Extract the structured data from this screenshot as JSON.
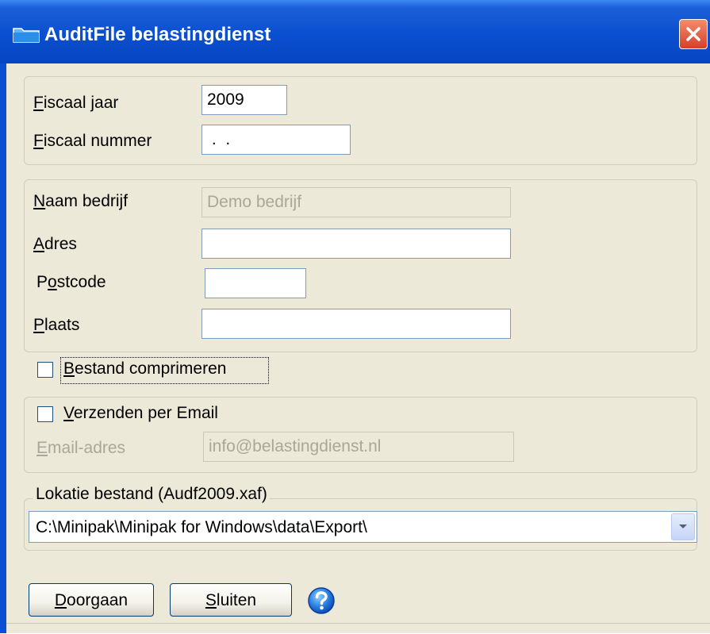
{
  "window": {
    "title": "AuditFile belastingdienst"
  },
  "fiscal": {
    "year_label_first": "F",
    "year_label_rest": "iscaal jaar",
    "year_value": "2009",
    "number_label_first": "F",
    "number_label_rest": "iscaal nummer",
    "number_value": " .  ."
  },
  "company": {
    "name_label_first": "N",
    "name_label_rest": "aam bedrijf",
    "name_value": "Demo bedrijf",
    "address_label_first": "A",
    "address_label_rest": "dres",
    "address_value": "",
    "postcode_label_pre": "P",
    "postcode_label_u": "o",
    "postcode_label_rest": "stcode",
    "postcode_value": "",
    "city_label_first": "P",
    "city_label_rest": "laats",
    "city_value": ""
  },
  "compress": {
    "label_first": "B",
    "label_rest": "estand comprimeren",
    "checked": false
  },
  "email": {
    "checkbox_label_first": "V",
    "checkbox_label_rest": "erzenden per Email",
    "checked": false,
    "address_label_first": "E",
    "address_label_rest": "mail-adres",
    "address_value": "info@belastingdienst.nl"
  },
  "location": {
    "legend": "Lokatie bestand (Audf2009.xaf)",
    "path_value": "C:\\Minipak\\Minipak for Windows\\data\\Export\\"
  },
  "buttons": {
    "continue_first": "D",
    "continue_rest": "oorgaan",
    "close_first": "S",
    "close_rest": "luiten"
  },
  "icons": {
    "window": "folder-icon",
    "close": "close-icon",
    "help": "help-icon",
    "dropdown": "chevron-down-icon"
  },
  "colors": {
    "titlebar": "#0a4fd0",
    "dialog_bg": "#ece9d8",
    "close_button": "#d4402a",
    "field_border": "#7f9db9",
    "disabled_text": "#a8a799"
  }
}
